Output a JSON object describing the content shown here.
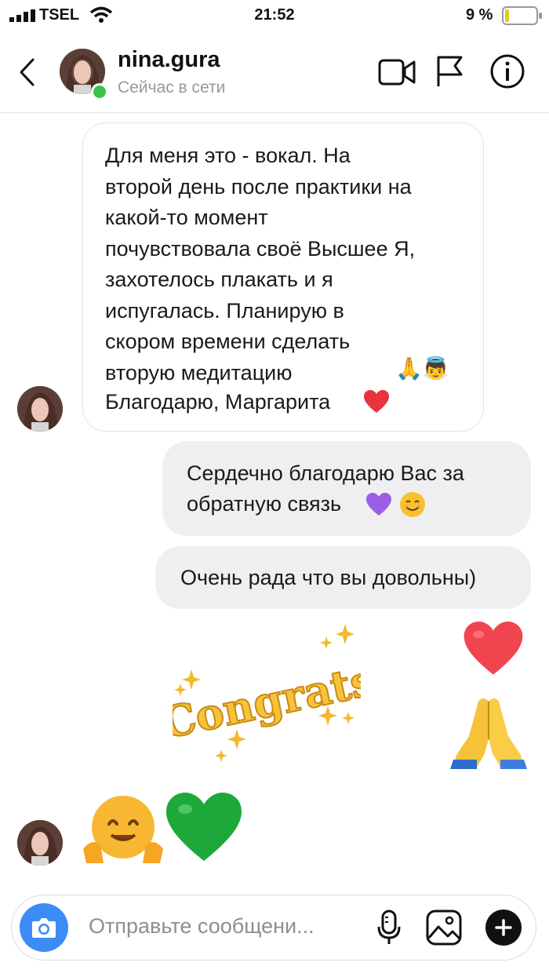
{
  "status_bar": {
    "carrier": "TSEL",
    "time": "21:52",
    "battery": "9 %"
  },
  "header": {
    "username": "nina.gura",
    "presence": "Сейчас в сети"
  },
  "messages": {
    "incoming_1": "Для меня это - вокал. На\nвторой день после практики на\nкакой-то момент\nпочувствовала своё Высшее Я,\nзахотелось плакать и я\nиспугалась. Планирую в\nскором времени сделать\nвторую медитацию",
    "incoming_1_end": "Благодарю, Маргарита",
    "outgoing_1_line1": "Сердечно благодарю Вас за",
    "outgoing_1_line2": "обратную связь",
    "outgoing_2": "Очень рада что вы довольны)",
    "sticker": "Congrats"
  },
  "composer": {
    "placeholder": "Отправьте сообщени..."
  },
  "colors": {
    "online": "#3cc34a",
    "accent_blue": "#3b8cf5",
    "heart_red": "#f0454f",
    "green_heart": "#1fa83a",
    "purple_heart": "#9b5de5",
    "gold": "#f4b82a"
  },
  "icons": [
    "back-icon",
    "video-call-icon",
    "flag-icon",
    "info-icon",
    "camera-icon",
    "microphone-icon",
    "gallery-icon",
    "plus-icon",
    "signal-icon",
    "wifi-icon",
    "battery-icon"
  ]
}
